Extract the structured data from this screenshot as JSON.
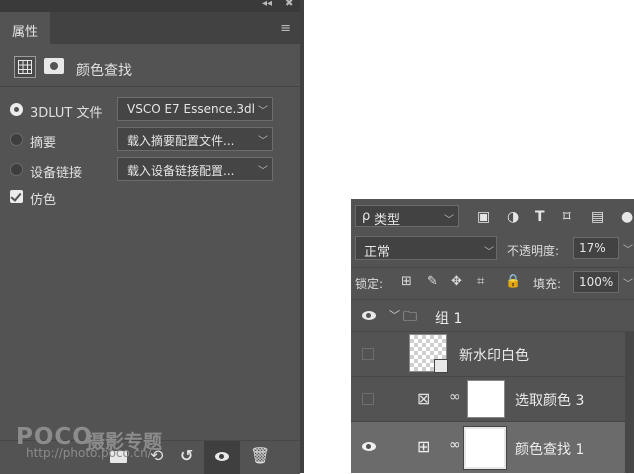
{
  "properties_panel": {
    "tab_label": "属性",
    "collapse_glyph": "◂◂",
    "close_glyph": "✖",
    "menu_glyph": "≡",
    "adjustment_title": "颜色查找",
    "options": [
      {
        "label": "3DLUT 文件",
        "selected": true,
        "value": "VSCO E7 Essence.3dl"
      },
      {
        "label": "摘要",
        "selected": false,
        "value": "载入摘要配置文件..."
      },
      {
        "label": "设备链接",
        "selected": false,
        "value": "载入设备链接配置..."
      }
    ],
    "dither_label": "仿色",
    "dither_checked": true,
    "dropdown_glyph": "﹀"
  },
  "watermark": {
    "brand": "POCO",
    "title": "摄影专题",
    "url": "http://photo.poco.cn/"
  },
  "layers_panel": {
    "filter_prefix": "ρ",
    "filter_label": "类型",
    "blend_mode": "正常",
    "opacity_label": "不透明度:",
    "opacity_value": "17%",
    "lock_label": "锁定:",
    "fill_label": "填充:",
    "fill_value": "100%",
    "layers": [
      {
        "name": "组 1",
        "kind": "group",
        "visible": true
      },
      {
        "name": "新水印白色",
        "kind": "smart-object",
        "visible": false
      },
      {
        "name": "选取颜色 3",
        "kind": "adjustment",
        "visible": false
      },
      {
        "name": "颜色查找 1",
        "kind": "adjustment",
        "visible": true,
        "selected": true
      }
    ]
  },
  "colors": {
    "panel_bg": "#535353",
    "panel_dark": "#424242",
    "selected_row": "#6b6b6b",
    "text": "#e0e0e0"
  }
}
